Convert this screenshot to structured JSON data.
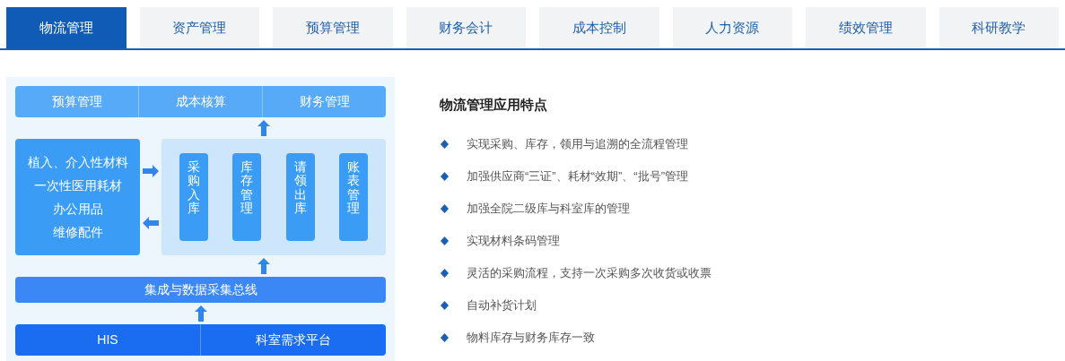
{
  "tabs": [
    {
      "label": "物流管理",
      "selected": true
    },
    {
      "label": "资产管理",
      "selected": false
    },
    {
      "label": "预算管理",
      "selected": false
    },
    {
      "label": "财务会计",
      "selected": false
    },
    {
      "label": "成本控制",
      "selected": false
    },
    {
      "label": "人力资源",
      "selected": false
    },
    {
      "label": "绩效管理",
      "selected": false
    },
    {
      "label": "科研教学",
      "selected": false
    }
  ],
  "diagram": {
    "top_modules": [
      "预算管理",
      "成本核算",
      "财务管理"
    ],
    "materials": [
      "植入、介入性材料",
      "一次性医用耗材",
      "办公用品",
      "维修配件"
    ],
    "processes": [
      "采购入库",
      "库存管理",
      "请领出库",
      "账表管理"
    ],
    "bus": "集成与数据采集总线",
    "sources": [
      "HIS",
      "科室需求平台"
    ]
  },
  "features": {
    "title": "物流管理应用特点",
    "items": [
      "实现采购、库存，领用与追溯的全流程管理",
      "加强供应商“三证”、耗材“效期”、“批号”管理",
      "加强全院二级库与科室库的管理",
      "实现材料条码管理",
      "灵活的采购流程，支持一次采购多次收货或收票",
      "自动补货计划",
      "物料库存与财务库存一致"
    ]
  }
}
